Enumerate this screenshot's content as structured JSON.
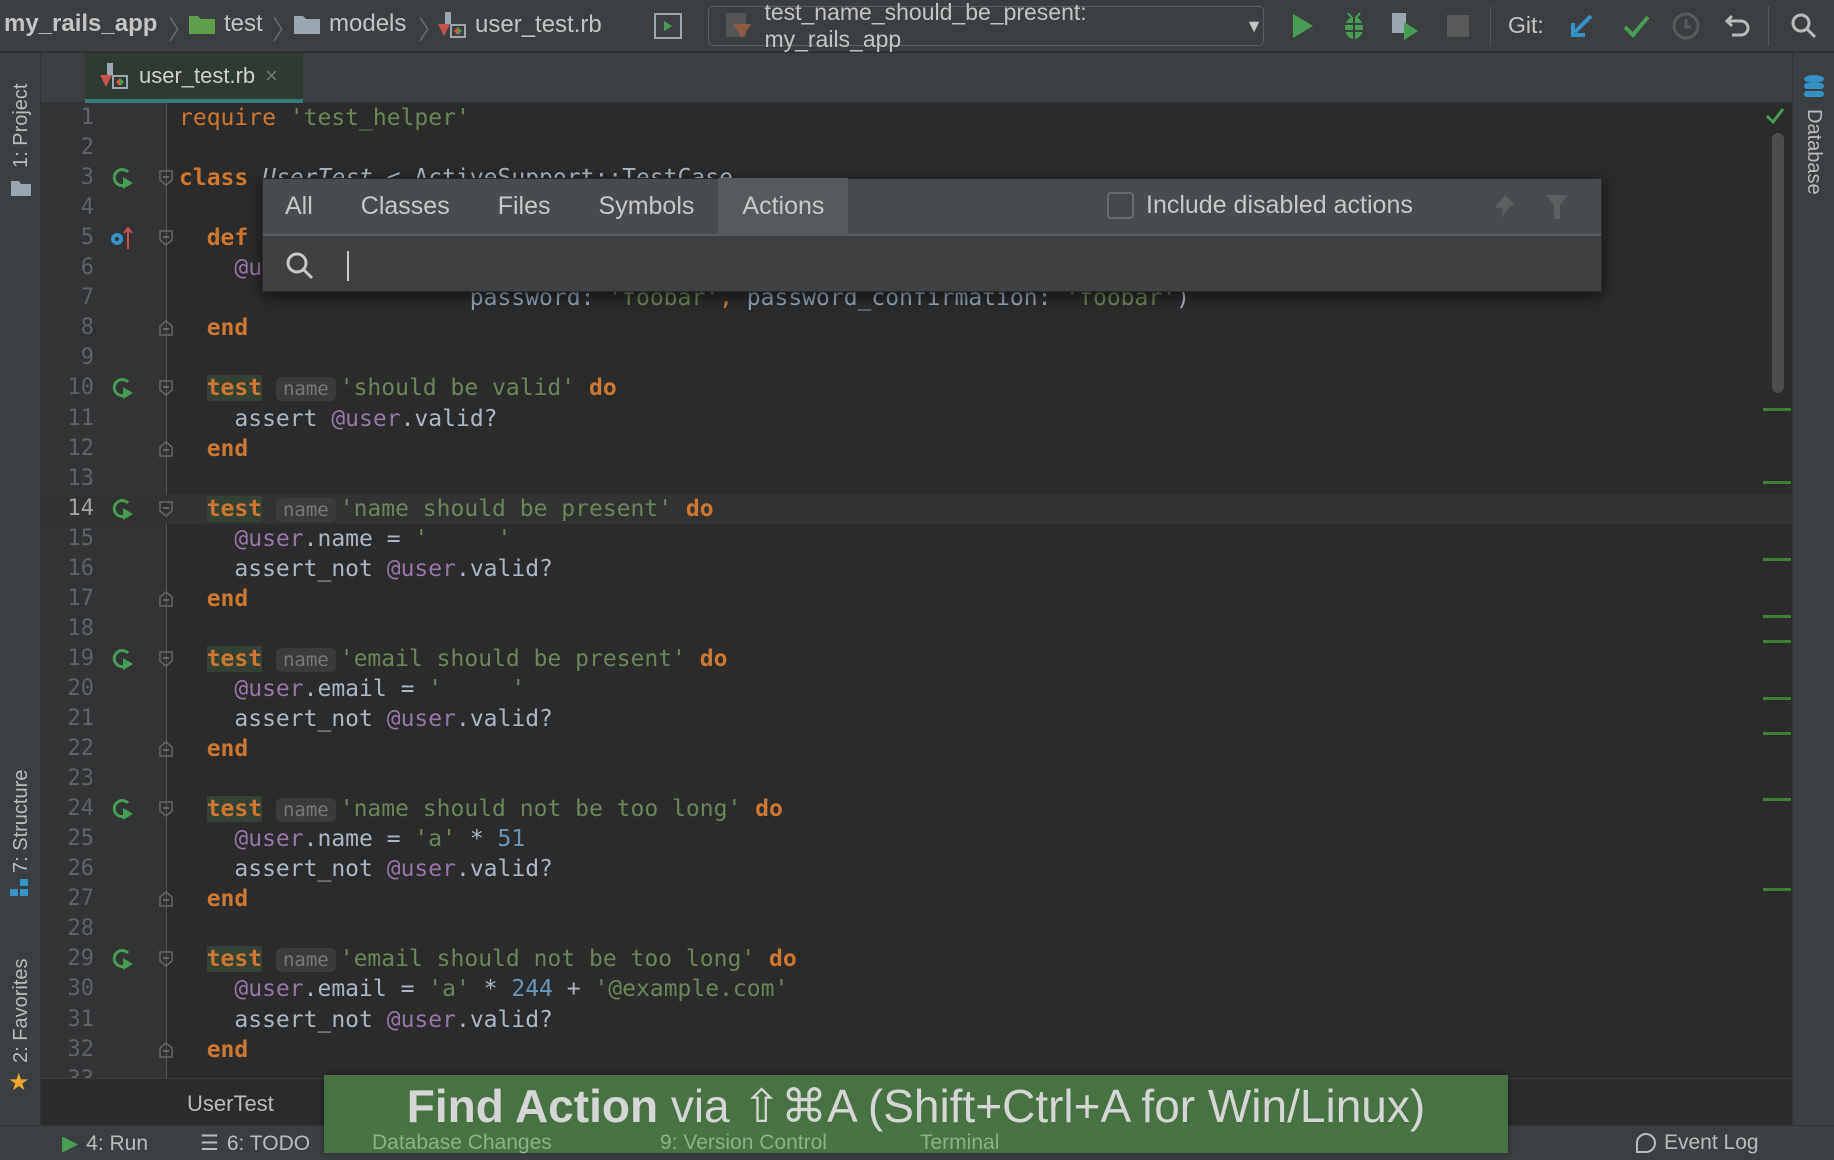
{
  "navbar": {
    "breadcrumbs": [
      "my_rails_app",
      "test",
      "models",
      "user_test.rb"
    ],
    "run_config": "test_name_should_be_present: my_rails_app",
    "git_label": "Git:",
    "icons": [
      "run-icon",
      "debug-icon",
      "coverage-icon",
      "stop-icon",
      "git-update-icon",
      "git-commit-icon",
      "history-icon",
      "revert-icon",
      "search-icon"
    ]
  },
  "editor_tab": {
    "label": "user_test.rb",
    "close": "×"
  },
  "left_strip": {
    "project": "1: Project",
    "structure": "7: Structure",
    "favorites": "2: Favorites"
  },
  "right_strip": {
    "database": "Database"
  },
  "popup": {
    "tabs": [
      "All",
      "Classes",
      "Files",
      "Symbols",
      "Actions"
    ],
    "selected_tab": "Actions",
    "include_disabled_label": "Include disabled actions",
    "include_disabled_checked": false,
    "search_value": ""
  },
  "code": {
    "current_line": 14,
    "lines": [
      {
        "n": "1",
        "tokens": [
          [
            "kwc",
            "require"
          ],
          [
            "pl",
            " "
          ],
          [
            "str",
            "'test_helper'"
          ]
        ]
      },
      {
        "n": "2",
        "tokens": []
      },
      {
        "n": "3",
        "gutter": "run",
        "fold": "start",
        "tokens": [
          [
            "kw",
            "class"
          ],
          [
            "pl",
            " "
          ],
          [
            "cst",
            "UserTest"
          ],
          [
            "pl",
            " < ActiveSupport::TestCase"
          ]
        ]
      },
      {
        "n": "4",
        "tokens": []
      },
      {
        "n": "5",
        "gutter": "override",
        "fold": "start",
        "tokens": [
          [
            "pl",
            "  "
          ],
          [
            "kw",
            "def"
          ]
        ]
      },
      {
        "n": "6",
        "tokens": [
          [
            "pl",
            "    "
          ],
          [
            "iv",
            "@u"
          ]
        ]
      },
      {
        "n": "7",
        "tokens": [
          [
            "pl",
            "                     "
          ],
          [
            "sym",
            "password:"
          ],
          [
            "pl",
            " "
          ],
          [
            "str",
            "'foobar'"
          ],
          [
            "kwc",
            ","
          ],
          [
            "pl",
            " "
          ],
          [
            "sym",
            "password_confirmation:"
          ],
          [
            "pl",
            " "
          ],
          [
            "str",
            "'foobar'"
          ],
          [
            "pl",
            ")"
          ]
        ]
      },
      {
        "n": "8",
        "fold": "end",
        "tokens": [
          [
            "pl",
            "  "
          ],
          [
            "kw",
            "end"
          ]
        ]
      },
      {
        "n": "9",
        "tokens": []
      },
      {
        "n": "10",
        "gutter": "run",
        "fold": "start",
        "tokens": [
          [
            "pl",
            "  "
          ],
          [
            "tkw",
            "test"
          ],
          [
            "pl",
            " "
          ],
          [
            "hint",
            "name"
          ],
          [
            "str",
            "'should be valid'"
          ],
          [
            "pl",
            " "
          ],
          [
            "kw",
            "do"
          ]
        ]
      },
      {
        "n": "11",
        "tokens": [
          [
            "pl",
            "    assert "
          ],
          [
            "iv",
            "@user"
          ],
          [
            "pl",
            ".valid?"
          ]
        ]
      },
      {
        "n": "12",
        "fold": "end",
        "tokens": [
          [
            "pl",
            "  "
          ],
          [
            "kw",
            "end"
          ]
        ]
      },
      {
        "n": "13",
        "tokens": []
      },
      {
        "n": "14",
        "gutter": "run",
        "fold": "start",
        "tokens": [
          [
            "pl",
            "  "
          ],
          [
            "tkw",
            "test"
          ],
          [
            "pl",
            " "
          ],
          [
            "hint",
            "name"
          ],
          [
            "str",
            "'name should be present'"
          ],
          [
            "pl",
            " "
          ],
          [
            "kw",
            "do"
          ]
        ]
      },
      {
        "n": "15",
        "tokens": [
          [
            "pl",
            "    "
          ],
          [
            "iv",
            "@user"
          ],
          [
            "pl",
            ".name = "
          ],
          [
            "str",
            "'     '"
          ]
        ]
      },
      {
        "n": "16",
        "tokens": [
          [
            "pl",
            "    assert_not "
          ],
          [
            "iv",
            "@user"
          ],
          [
            "pl",
            ".valid?"
          ]
        ]
      },
      {
        "n": "17",
        "fold": "end",
        "tokens": [
          [
            "pl",
            "  "
          ],
          [
            "kw",
            "end"
          ]
        ]
      },
      {
        "n": "18",
        "tokens": []
      },
      {
        "n": "19",
        "gutter": "run",
        "fold": "start",
        "tokens": [
          [
            "pl",
            "  "
          ],
          [
            "tkw",
            "test"
          ],
          [
            "pl",
            " "
          ],
          [
            "hint",
            "name"
          ],
          [
            "str",
            "'email should be present'"
          ],
          [
            "pl",
            " "
          ],
          [
            "kw",
            "do"
          ]
        ]
      },
      {
        "n": "20",
        "tokens": [
          [
            "pl",
            "    "
          ],
          [
            "iv",
            "@user"
          ],
          [
            "pl",
            ".email = "
          ],
          [
            "str",
            "'     '"
          ]
        ]
      },
      {
        "n": "21",
        "tokens": [
          [
            "pl",
            "    assert_not "
          ],
          [
            "iv",
            "@user"
          ],
          [
            "pl",
            ".valid?"
          ]
        ]
      },
      {
        "n": "22",
        "fold": "end",
        "tokens": [
          [
            "pl",
            "  "
          ],
          [
            "kw",
            "end"
          ]
        ]
      },
      {
        "n": "23",
        "tokens": []
      },
      {
        "n": "24",
        "gutter": "run",
        "fold": "start",
        "tokens": [
          [
            "pl",
            "  "
          ],
          [
            "tkw",
            "test"
          ],
          [
            "pl",
            " "
          ],
          [
            "hint",
            "name"
          ],
          [
            "str",
            "'name should not be too long'"
          ],
          [
            "pl",
            " "
          ],
          [
            "kw",
            "do"
          ]
        ]
      },
      {
        "n": "25",
        "tokens": [
          [
            "pl",
            "    "
          ],
          [
            "iv",
            "@user"
          ],
          [
            "pl",
            ".name = "
          ],
          [
            "str",
            "'a'"
          ],
          [
            "pl",
            " * "
          ],
          [
            "num",
            "51"
          ]
        ]
      },
      {
        "n": "26",
        "tokens": [
          [
            "pl",
            "    assert_not "
          ],
          [
            "iv",
            "@user"
          ],
          [
            "pl",
            ".valid?"
          ]
        ]
      },
      {
        "n": "27",
        "fold": "end",
        "tokens": [
          [
            "pl",
            "  "
          ],
          [
            "kw",
            "end"
          ]
        ]
      },
      {
        "n": "28",
        "tokens": []
      },
      {
        "n": "29",
        "gutter": "run",
        "fold": "start",
        "tokens": [
          [
            "pl",
            "  "
          ],
          [
            "tkw",
            "test"
          ],
          [
            "pl",
            " "
          ],
          [
            "hint",
            "name"
          ],
          [
            "str",
            "'email should not be too long'"
          ],
          [
            "pl",
            " "
          ],
          [
            "kw",
            "do"
          ]
        ]
      },
      {
        "n": "30",
        "tokens": [
          [
            "pl",
            "    "
          ],
          [
            "iv",
            "@user"
          ],
          [
            "pl",
            ".email = "
          ],
          [
            "str",
            "'a'"
          ],
          [
            "pl",
            " * "
          ],
          [
            "num",
            "244"
          ],
          [
            "pl",
            " + "
          ],
          [
            "str",
            "'@example.com'"
          ]
        ]
      },
      {
        "n": "31",
        "tokens": [
          [
            "pl",
            "    assert_not "
          ],
          [
            "iv",
            "@user"
          ],
          [
            "pl",
            ".valid?"
          ]
        ]
      },
      {
        "n": "32",
        "fold": "end",
        "tokens": [
          [
            "pl",
            "  "
          ],
          [
            "kw",
            "end"
          ]
        ]
      },
      {
        "n": "33",
        "tokens": []
      }
    ]
  },
  "editor_breadcrumb": "UserTest",
  "statusbar": {
    "run": "4: Run",
    "todo": "6: TODO",
    "db_changes": "Database Changes",
    "vcs": "9: Version Control",
    "terminal": "Terminal",
    "event_log": "Event Log"
  },
  "banner": {
    "bold": "Find Action",
    "rest": " via ⇧⌘A (Shift+Ctrl+A for Win/Linux)"
  },
  "colors": {
    "keyword": "#cc7832",
    "string": "#6a8759",
    "ivar": "#9876aa",
    "number": "#6897bb",
    "banner": "#4a7645",
    "run_green": "#499c54"
  }
}
